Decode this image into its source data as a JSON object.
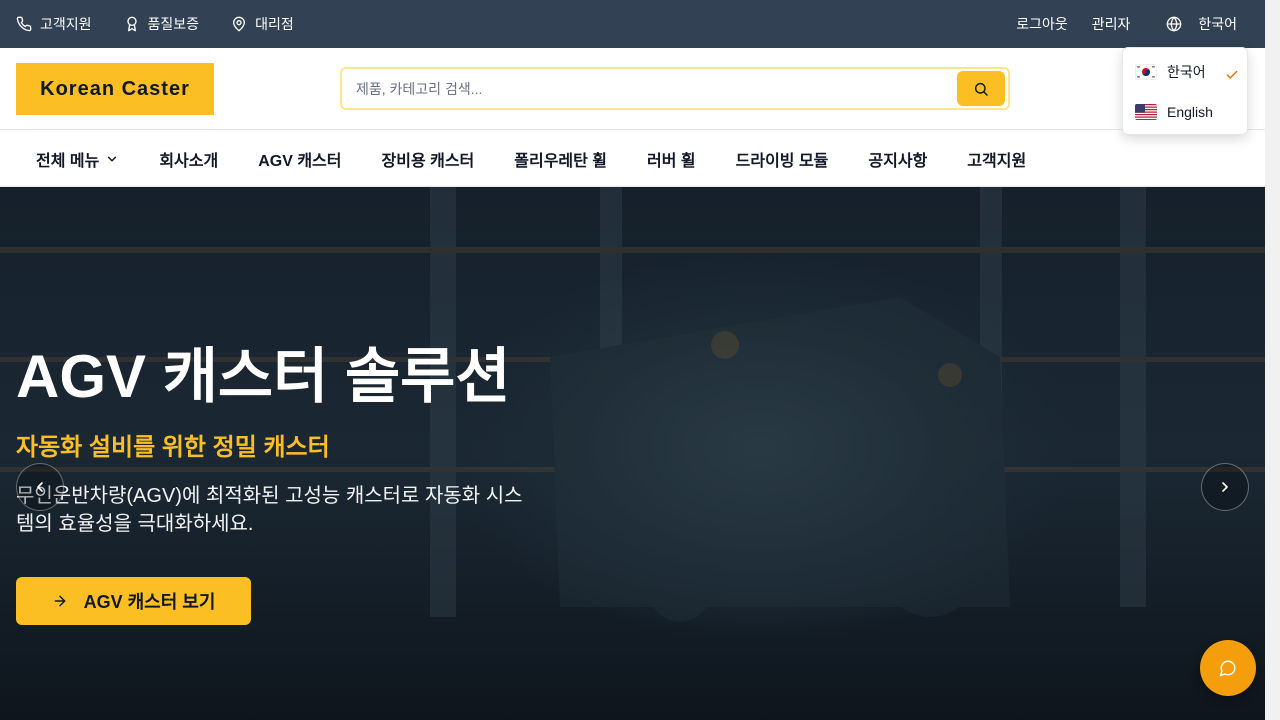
{
  "topbar": {
    "support": "고객지원",
    "quality": "품질보증",
    "dealer": "대리점",
    "logout": "로그아웃",
    "admin": "관리자",
    "language": "한국어"
  },
  "header": {
    "logo": "Korean Caster",
    "search_placeholder": "제품, 카테고리 검색..."
  },
  "nav": {
    "items": [
      "전체 메뉴",
      "회사소개",
      "AGV 캐스터",
      "장비용 캐스터",
      "폴리우레탄 휠",
      "러버 휠",
      "드라이빙 모듈",
      "공지사항",
      "고객지원"
    ]
  },
  "hero": {
    "title": "AGV 캐스터 솔루션",
    "subtitle": "자동화 설비를 위한 정밀 캐스터",
    "description": "무인운반차량(AGV)에 최적화된 고성능 캐스터로 자동화 시스템의 효율성을 극대화하세요.",
    "cta": "AGV 캐스터 보기"
  },
  "language_dropdown": {
    "options": [
      {
        "label": "한국어",
        "selected": true
      },
      {
        "label": "English",
        "selected": false
      }
    ]
  },
  "colors": {
    "accent": "#fbbf24",
    "topbar": "#334155",
    "chat": "#f59e0b"
  }
}
